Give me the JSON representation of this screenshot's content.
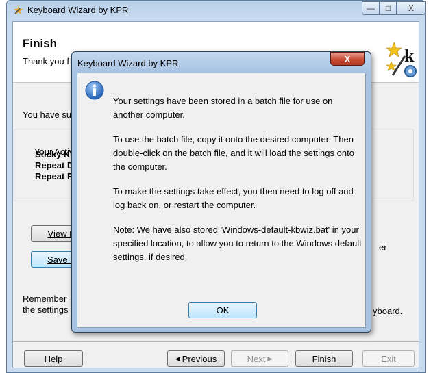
{
  "window": {
    "title": "Keyboard Wizard by KPR",
    "minimize": "—",
    "maximize": "□",
    "close": "X"
  },
  "header": {
    "title": "Finish",
    "subtitle": "Thank you f"
  },
  "body": {
    "line1": "You have su",
    "group_label": "Your Activ",
    "settings": [
      "Sticky Ke",
      "Repeat D",
      "Repeat R"
    ],
    "view_button": "View R",
    "save_button": "Save B",
    "save_tail": "er",
    "remember_line1": "Remember",
    "remember_line2": "the settings",
    "keyboard_tail": "yboard."
  },
  "footer": {
    "help": "Help",
    "previous": "Previous",
    "next": "Next",
    "finish": "Finish",
    "exit": "Exit"
  },
  "dialog": {
    "title": "Keyboard Wizard by KPR",
    "close": "X",
    "paragraphs": [
      "Your settings have been stored in a batch file for use on another computer.",
      "To use the batch file, copy it onto the desired computer. Then double-click on the batch file, and it will load the settings onto the computer.",
      "To make the settings take effect, you then need to log off and log back on, or restart the computer.",
      "Note: We have also stored 'Windows-default-kbwiz.bat' in your specified location, to allow you to return to the Windows default settings, if desired."
    ],
    "ok": "OK"
  },
  "icons": {
    "app": "keyboard-wizard-icon",
    "logo": "wand-stars-k-gear-logo",
    "info": "info-icon"
  },
  "colors": {
    "title_bar": "#b9d1ea",
    "dialog_close": "#c74a34",
    "info_blue": "#2f6fc8"
  }
}
